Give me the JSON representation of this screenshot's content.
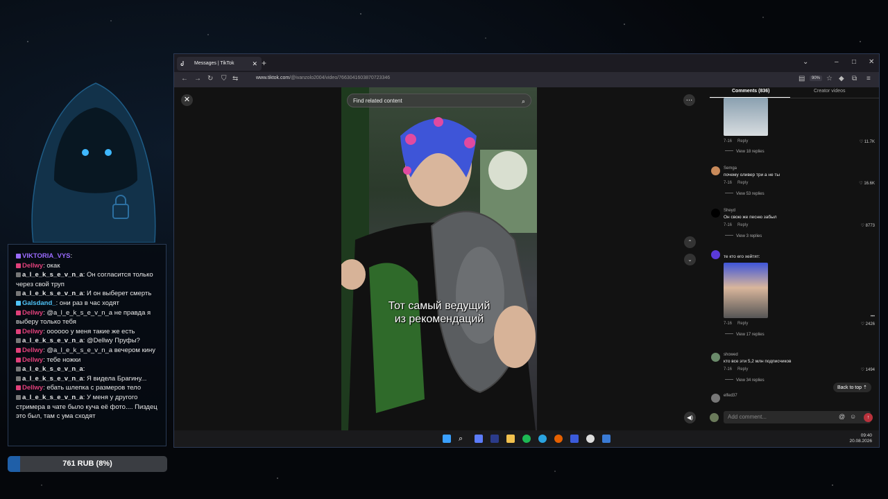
{
  "browser": {
    "tab_title": "Messages | TikTok",
    "url_host": "www.tiktok.com",
    "url_path": "/@ivanzolo2004/video/7663041603870723346",
    "zoom": "90%"
  },
  "video": {
    "search_placeholder": "Find related content",
    "caption_line1": "Тот самый ведущий",
    "caption_line2": "из рекомендаций"
  },
  "comments": {
    "tab_comments": "Comments (836)",
    "tab_creator": "Creator videos",
    "reply_label": "Reply",
    "items": [
      {
        "user": "",
        "text": "",
        "date": "7-16",
        "likes": "11.7K",
        "replies": "View 18 replies"
      },
      {
        "user": "Semga",
        "text": "почему оливер три а не ты",
        "date": "7-16",
        "likes": "16.6K",
        "replies": "View 53 replies"
      },
      {
        "user": "Sheyd",
        "text": "Он свою же песню забыл",
        "date": "7-16",
        "likes": "8773",
        "replies": "View 3 replies"
      },
      {
        "user": "",
        "text": "те кто его хейтят:",
        "date": "7-16",
        "likes": "2426",
        "replies": "View 17 replies"
      },
      {
        "user": "showed",
        "text": "кто все эти 5,2 млн подписчиков",
        "date": "7-16",
        "likes": "1494",
        "replies": "View 34 replies"
      },
      {
        "user": "elfed37",
        "text": "",
        "date": "",
        "likes": "",
        "replies": ""
      }
    ],
    "back_to_top": "Back to top",
    "add_placeholder": "Add comment..."
  },
  "chat": {
    "lines": [
      {
        "nick": "VIKTORIA_VYS",
        "nick_color": "#9b6bff",
        "text": ""
      },
      {
        "nick": "Dellwy",
        "nick_color": "#e0407a",
        "text": "окак"
      },
      {
        "nick": "a_l_e_k_s_e_v_n_a",
        "nick_color": "#e8e8e8",
        "text": "Он согласится только через свой труп"
      },
      {
        "nick": "a_l_e_k_s_e_v_n_a",
        "nick_color": "#e8e8e8",
        "text": "И он выберет смерть"
      },
      {
        "nick": "Galsdand_",
        "nick_color": "#4fc3f7",
        "text": "они раз в час ходят"
      },
      {
        "nick": "Dellwy",
        "nick_color": "#e0407a",
        "text": "@a_l_e_k_s_e_v_n_a не правда я выберу только тебя"
      },
      {
        "nick": "Dellwy",
        "nick_color": "#e0407a",
        "text": "оооооо у меня такие же есть"
      },
      {
        "nick": "a_l_e_k_s_e_v_n_a",
        "nick_color": "#e8e8e8",
        "text": "@Dellwy Пруфы?"
      },
      {
        "nick": "Dellwy",
        "nick_color": "#e0407a",
        "text": "@a_l_e_k_s_e_v_n_a вечером кину"
      },
      {
        "nick": "Dellwy",
        "nick_color": "#e0407a",
        "text": "тебе ножки"
      },
      {
        "nick": "a_l_e_k_s_e_v_n_a",
        "nick_color": "#e8e8e8",
        "text": ""
      },
      {
        "nick": "a_l_e_k_s_e_v_n_a",
        "nick_color": "#e8e8e8",
        "text": "Я видела Брагину..."
      },
      {
        "nick": "Dellwy",
        "nick_color": "#e0407a",
        "text": "ебать шлепка с размеров тело"
      },
      {
        "nick": "a_l_e_k_s_e_v_n_a",
        "nick_color": "#e8e8e8",
        "text": "У меня у другого стримера в чате было куча её фото.... Пиздец это был, там с ума сходят"
      }
    ]
  },
  "donation": {
    "label": "761 RUB (8%)",
    "fraction": 0.08
  },
  "taskbar": {
    "time": "09:40",
    "date": "20.08.2026"
  }
}
